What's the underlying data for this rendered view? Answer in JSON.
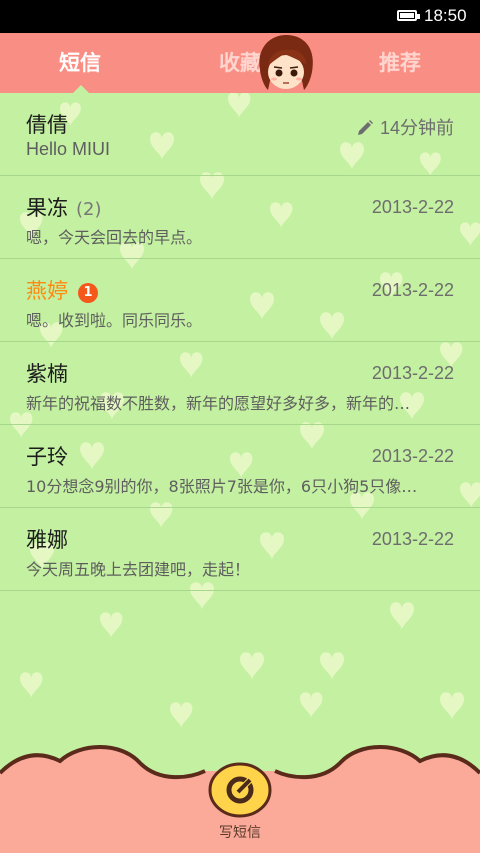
{
  "status_bar": {
    "time": "18:50"
  },
  "tabs": [
    {
      "label": "短信",
      "active": true
    },
    {
      "label": "收藏",
      "active": false
    },
    {
      "label": "推荐",
      "active": false
    }
  ],
  "messages": [
    {
      "name": "倩倩",
      "count": "",
      "badge": "",
      "date": "14分钟前",
      "draft": true,
      "preview": "Hello MIUI",
      "unread": false
    },
    {
      "name": "果冻",
      "count": "(2)",
      "badge": "",
      "date": "2013-2-22",
      "draft": false,
      "preview": "嗯，今天会回去的早点。",
      "unread": false
    },
    {
      "name": "燕婷",
      "count": "",
      "badge": "1",
      "date": "2013-2-22",
      "draft": false,
      "preview": "嗯。收到啦。同乐同乐。",
      "unread": true
    },
    {
      "name": "紫楠",
      "count": "",
      "badge": "",
      "date": "2013-2-22",
      "draft": false,
      "preview": "新年的祝福数不胜数，新年的愿望好多好多，新年的…",
      "unread": false
    },
    {
      "name": "子玲",
      "count": "",
      "badge": "",
      "date": "2013-2-22",
      "draft": false,
      "preview": "10分想念9别的你，8张照片7张是你，6只小狗5只像…",
      "unread": false
    },
    {
      "name": "雅娜",
      "count": "",
      "badge": "",
      "date": "2013-2-22",
      "draft": false,
      "preview": "今天周五晚上去团建吧，走起！",
      "unread": false
    }
  ],
  "compose": {
    "label": "写短信",
    "icon": "compose-icon"
  },
  "colors": {
    "background": "#c4f0a2",
    "tabbar": "#f98f84",
    "unread_name": "#ff8a10",
    "badge": "#f5581b"
  }
}
